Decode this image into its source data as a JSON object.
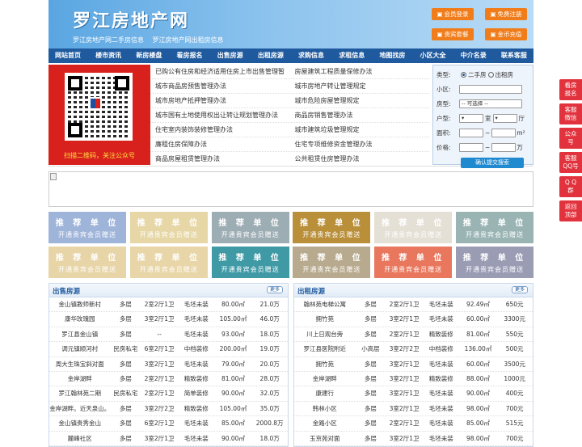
{
  "header": {
    "title": "罗江房地产网",
    "links": [
      "罗江房地产网二手房信息",
      "罗江房地产网出租房信息"
    ],
    "buttons": [
      {
        "label": "会员登录"
      },
      {
        "label": "免费注册"
      },
      {
        "label": "贵宾套餐"
      },
      {
        "label": "金币充值"
      }
    ]
  },
  "nav": [
    "网站首页",
    "楼市资讯",
    "新房楼盘",
    "看房报名",
    "出售房源",
    "出租房源",
    "求购信息",
    "求租信息",
    "地图找房",
    "小区大全",
    "中介名录",
    "联系客服"
  ],
  "qr": {
    "caption": "扫描二维码，关注公众号"
  },
  "news": [
    [
      "已购公有住房和经济适用住房上市出售管理暂",
      "房屋建筑工程质量保修办法"
    ],
    [
      "城市商品房预售管理办法",
      "城市房地产转让管理规定"
    ],
    [
      "城市房地产抵押管理办法",
      "城市危险房屋管理规定"
    ],
    [
      "城市国有土地使用权出让转让规划管理办法",
      "商品房销售管理办法"
    ],
    [
      "住宅室内装饰装修管理办法",
      "城市建筑垃圾管理规定"
    ],
    [
      "廉租住房保障办法",
      "住宅专项维修资金管理办法"
    ],
    [
      "商品房屋租赁管理办法",
      "公共租赁住房管理办法"
    ]
  ],
  "search": {
    "type_label": "类型:",
    "opt1": "二手房",
    "opt2": "出租房",
    "community_label": "小区:",
    "house_label": "房型:",
    "house_select": "-- 可选择 --",
    "layout_label": "户型:",
    "room_unit": "室",
    "hall_unit": "厅",
    "area_label": "面积:",
    "price_label": "价格:",
    "tilde": "~",
    "area_unit": "m²",
    "price_unit": "万",
    "submit": "确认提交搜索"
  },
  "promo": {
    "title": "推 荐 单 位",
    "sub": "开通贵宾会员赠送",
    "colors": [
      "#9fb4d9",
      "#e7d7a6",
      "#9dadb4",
      "#b98f3a",
      "#e4e0d6",
      "#9ab4b4",
      "#e7d5a8",
      "#e8d6a8",
      "#3f9aa6",
      "#b8aa8e",
      "#e8775d",
      "#9a9cb4"
    ]
  },
  "sale": {
    "title": "出售房源",
    "more": "更多",
    "rows": [
      [
        "金山镇教师新村",
        "多层",
        "2室2厅1卫",
        "毛坯未装",
        "80.00㎡",
        "21.0万"
      ],
      [
        "康华玫瑰园",
        "多层",
        "3室2厅1卫",
        "毛坯未装",
        "105.00㎡",
        "46.0万"
      ],
      [
        "罗江县金山镇",
        "多层",
        "--",
        "毛坯未装",
        "93.00㎡",
        "18.0万"
      ],
      [
        "调元镇顺河村",
        "民房私宅",
        "6室2厅1卫",
        "中档装修",
        "200.00㎡",
        "19.0万"
      ],
      [
        "周大生珠宝斜对面",
        "多层",
        "3室2厅1卫",
        "毛坯未装",
        "79.00㎡",
        "20.0万"
      ],
      [
        "金岸湖畔",
        "多层",
        "2室2厅1卫",
        "精致装修",
        "81.00㎡",
        "28.0万"
      ],
      [
        "罗江翰林苑二期",
        "民房私宅",
        "2室2厅1卫",
        "简单装修",
        "90.00㎡",
        "32.0万"
      ],
      [
        "金岸湖畔。近天泉山。",
        "多层",
        "3室2厅2卫",
        "精致装修",
        "105.00㎡",
        "35.0万"
      ],
      [
        "金山镇贵秀金山",
        "多层",
        "6室2厅1卫",
        "毛坯未装",
        "85.00㎡",
        "2000.8万"
      ],
      [
        "麓峰社区",
        "多层",
        "3室2厅1卫",
        "毛坯未装",
        "90.00㎡",
        "18.0万"
      ]
    ]
  },
  "rent": {
    "title": "出租房源",
    "more": "更多",
    "rows": [
      [
        "翰林苑电梯公寓",
        "多层",
        "2室2厅1卫",
        "毛坯未装",
        "92.49㎡",
        "650元"
      ],
      [
        "拥竹苑",
        "多层",
        "3室2厅1卫",
        "毛坯未装",
        "60.00㎡",
        "3300元"
      ],
      [
        "川上日观台旁",
        "多层",
        "2室2厅1卫",
        "精致装修",
        "81.00㎡",
        "550元"
      ],
      [
        "罗江县医院附近",
        "小高层",
        "3室2厅2卫",
        "中档装修",
        "136.00㎡",
        "500元"
      ],
      [
        "拥竹苑",
        "多层",
        "3室2厅1卫",
        "毛坯未装",
        "60.00㎡",
        "3500元"
      ],
      [
        "金岸湖畔",
        "多层",
        "3室2厅1卫",
        "精致装修",
        "88.00㎡",
        "1000元"
      ],
      [
        "康建行",
        "多层",
        "3室2厅1卫",
        "毛坯未装",
        "90.00㎡",
        "400元"
      ],
      [
        "韩林小区",
        "多层",
        "3室2厅1卫",
        "毛坯未装",
        "98.00㎡",
        "700元"
      ],
      [
        "金路小区",
        "多层",
        "2室2厅1卫",
        "毛坯未装",
        "85.00㎡",
        "515元"
      ],
      [
        "玉京苑对面",
        "多层",
        "3室2厅1卫",
        "毛坯未装",
        "98.00㎡",
        "700元"
      ]
    ]
  },
  "side": [
    [
      "看房",
      "报名"
    ],
    [
      "客服",
      "微信"
    ],
    [
      "公众",
      "号"
    ],
    [
      "客服",
      "QQ号"
    ],
    [
      "Q Q",
      "群"
    ],
    [
      "返回",
      "顶部"
    ]
  ]
}
